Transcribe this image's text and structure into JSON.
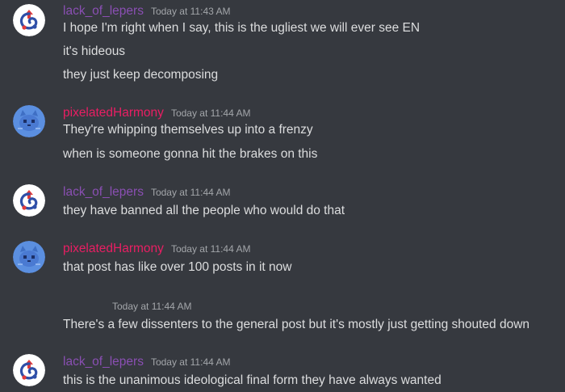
{
  "colors": {
    "background": "#36393f",
    "lack_of_lepers": "#8a4fb3",
    "pixelatedHarmony": "#e91e63",
    "message_text": "#dcddde",
    "timestamp": "#a3a6aa"
  },
  "messages": [
    {
      "author": "lack_of_lepers",
      "avatar_icon": "lack-of-lepers-avatar-icon",
      "timestamp": "Today at 11:43 AM",
      "lines": [
        "I hope I'm right when I say, this is the ugliest we will ever see EN",
        "it's hideous",
        "they just keep decomposing"
      ]
    },
    {
      "author": "pixelatedHarmony",
      "avatar_icon": "blue-cat-avatar-icon",
      "timestamp": "Today at 11:44 AM",
      "lines": [
        "They're whipping themselves up into a frenzy",
        "when is someone gonna hit the brakes on this"
      ]
    },
    {
      "author": "lack_of_lepers",
      "avatar_icon": "lack-of-lepers-avatar-icon",
      "timestamp": "Today at 11:44 AM",
      "lines": [
        "they have banned all the people who would do that"
      ]
    },
    {
      "author": "pixelatedHarmony",
      "avatar_icon": "blue-cat-avatar-icon",
      "timestamp": "Today at 11:44 AM",
      "lines": [
        "that post has like over 100 posts in it now"
      ]
    },
    {
      "timestamp": "Today at 11:44 AM",
      "lines": [
        "There's a few dissenters to the general post but it's mostly just getting shouted down"
      ]
    },
    {
      "author": "lack_of_lepers",
      "avatar_icon": "lack-of-lepers-avatar-icon",
      "timestamp": "Today at 11:44 AM",
      "lines": [
        "this is the unanimous ideological final form they have always wanted"
      ]
    }
  ]
}
